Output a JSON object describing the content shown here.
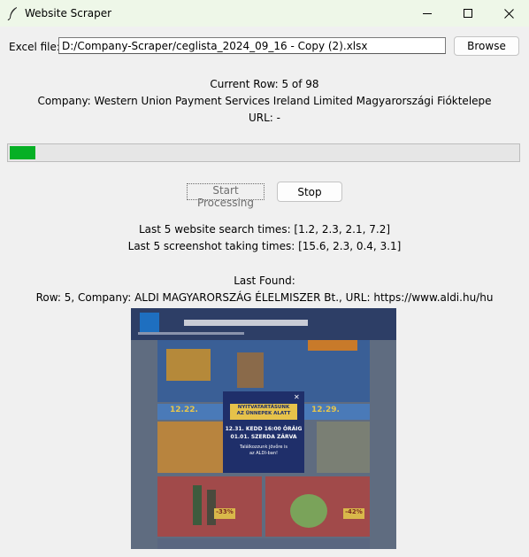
{
  "window": {
    "title": "Website Scraper",
    "controls": [
      "minimize",
      "maximize",
      "close"
    ]
  },
  "file": {
    "label": "Excel file:",
    "value": "D:/Company-Scraper/ceglista_2024_09_16 - Copy (2).xlsx",
    "browse_label": "Browse"
  },
  "status": {
    "current_row": "Current Row: 5 of 98",
    "company": "Company: Western Union Payment Services Ireland Limited Magyarországi Fióktelepe",
    "url": "URL: -"
  },
  "progress": {
    "current": 5,
    "total": 98,
    "color": "#06b025"
  },
  "actions": {
    "start_label": "Start Processing",
    "stop_label": "Stop"
  },
  "timings": {
    "search": "Last 5 website search times: [1.2, 2.3, 2.1, 7.2]",
    "screenshot": "Last 5 screenshot taking times: [15.6, 2.3, 0.4, 3.1]"
  },
  "last_found": {
    "heading": "Last Found:",
    "details": "Row: 5, Company: ALDI MAGYARORSZÁG ÉLELMISZER Bt., URL: https://www.aldi.hu/hu"
  },
  "preview": {
    "popup_line1": "NYITVATARTÁSUNK",
    "popup_line2": "AZ ÜNNEPEK ALATT",
    "popup_line3": "12.31. KEDD 16:00 ÓRÁIG",
    "popup_line4": "01.01. SZERDA ZÁRVA",
    "popup_line5": "Találkozzunk jövőre is",
    "popup_line6": "az ALDI-ban!",
    "promo_left": "-33%",
    "promo_right": "-42%",
    "date_left": "12.22.",
    "date_right": "12.29."
  }
}
